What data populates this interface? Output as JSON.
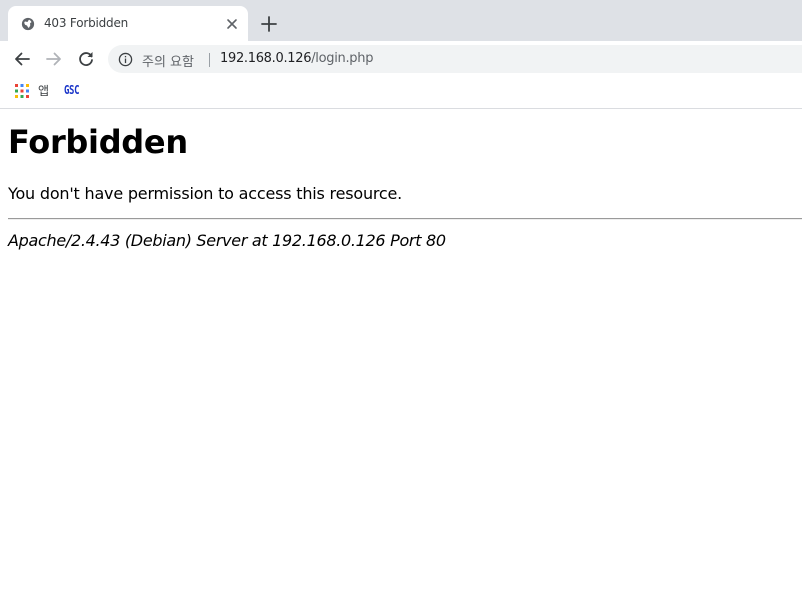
{
  "browser": {
    "tab": {
      "title": "403 Forbidden",
      "favicon": "globe-icon"
    },
    "toolbar": {
      "back_icon": "back-arrow-icon",
      "forward_icon": "forward-arrow-icon",
      "reload_icon": "reload-icon"
    },
    "omnibox": {
      "security_label": "주의 요함",
      "url_host": "192.168.0.126",
      "url_path": "/login.php"
    },
    "bookmarks": {
      "apps_label": "앱",
      "items": [
        {
          "label": "GSC"
        }
      ]
    }
  },
  "page": {
    "title": "Forbidden",
    "message": "You don't have permission to access this resource.",
    "server_signature": "Apache/2.4.43 (Debian) Server at 192.168.0.126 Port 80"
  },
  "colors": {
    "tabstrip_bg": "#dee1e6",
    "omnibox_bg": "#f1f3f4",
    "bookmark_gsc": "#1a35c9"
  }
}
